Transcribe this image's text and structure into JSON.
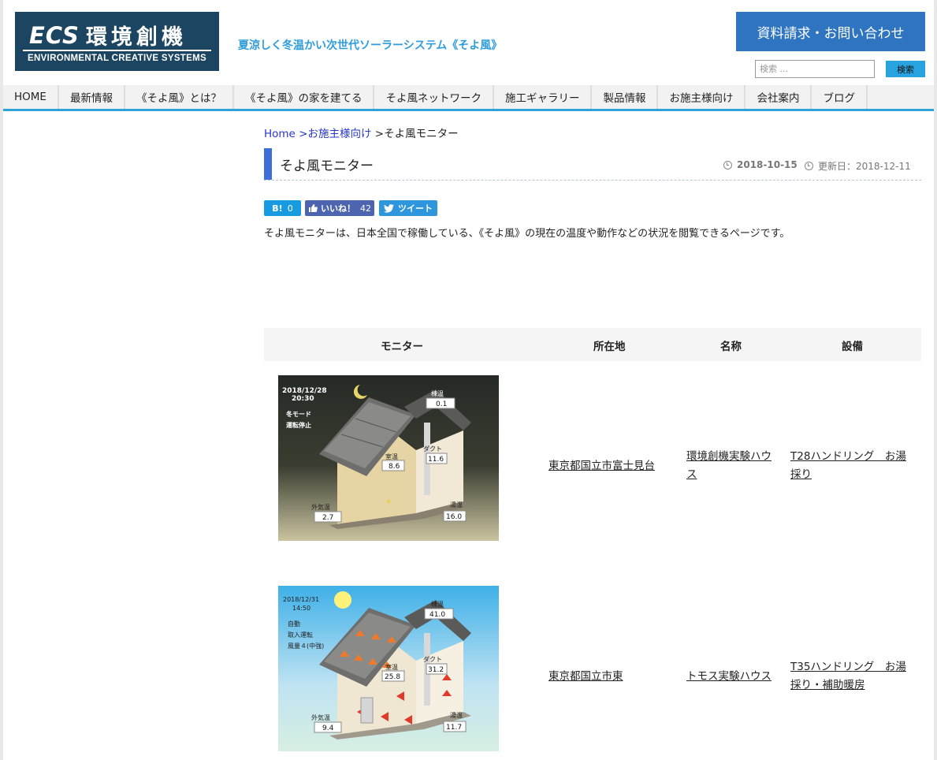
{
  "header": {
    "logo_ecs": "ECS",
    "logo_kanji": "環境創機",
    "logo_sub": "ENVIRONMENTAL CREATIVE SYSTEMS",
    "tagline": "夏涼しく冬温かい次世代ソーラーシステム《そよ風》",
    "contact_button": "資料請求・お問い合わせ",
    "search_placeholder": "検索 ...",
    "search_button": "検索"
  },
  "nav": [
    "HOME",
    "最新情報",
    "《そよ風》とは？",
    "《そよ風》の家を建てる",
    "そよ風ネットワーク",
    "施工ギャラリー",
    "製品情報",
    "お施主様向け",
    "会社案内",
    "ブログ"
  ],
  "breadcrumb": {
    "home": "Home",
    "sep1": " >",
    "parent": "お施主様向け",
    "sep2": " >",
    "current": "そよ風モニター"
  },
  "page": {
    "title": "そよ風モニター",
    "published": "2018-10-15",
    "updated": "更新日：2018-12-11",
    "intro": "そよ風モニターは、日本全国で稼働している、《そよ風》の現在の温度や動作などの状況を閲覧できるページです。"
  },
  "share": {
    "hatena_label": "B!",
    "hatena_count": "0",
    "fb_label": "いいね！",
    "fb_count": "42",
    "tw_label": "ツイート"
  },
  "table": {
    "headers": [
      "モニター",
      "所在地",
      "名称",
      "設備"
    ],
    "rows": [
      {
        "location": "東京都国立市富士見台",
        "name": "環境創機実験ハウス",
        "equipment": "T28ハンドリング　お湯採り",
        "monitor": {
          "datetime": "2018/12/28",
          "time": "20:30",
          "mode1": "冬モード",
          "mode2": "運転停止",
          "mode3": "",
          "roof_label": "棟温",
          "roof": "0.1",
          "duct_label": "ダクト",
          "duct": "11.6",
          "room_label": "室温",
          "room": "8.6",
          "outside_label": "外気温",
          "outside": "2.7",
          "water_label": "湯温",
          "water": "16.0"
        }
      },
      {
        "location": "東京都国立市東",
        "name": "トモス実験ハウス",
        "equipment": "T35ハンドリング　お湯採り・補助暖房",
        "monitor": {
          "datetime": "2018/12/31",
          "time": "14:50",
          "mode1": "自動",
          "mode2": "取入運転",
          "mode3": "風量４(中強)",
          "roof_label": "棟温",
          "roof": "41.0",
          "duct_label": "ダクト",
          "duct": "31.2",
          "room_label": "室温",
          "room": "25.8",
          "outside_label": "外気温",
          "outside": "9.4",
          "water_label": "湯温",
          "water": "11.7"
        }
      }
    ]
  },
  "colors": {
    "brand": "#1b4560",
    "accent": "#2e9cdb",
    "nav_border": "#2ea3d8",
    "link": "#2636c8"
  },
  "icons": [
    "clock-icon",
    "moon-icon",
    "sun-icon",
    "like-icon",
    "bird-icon"
  ]
}
